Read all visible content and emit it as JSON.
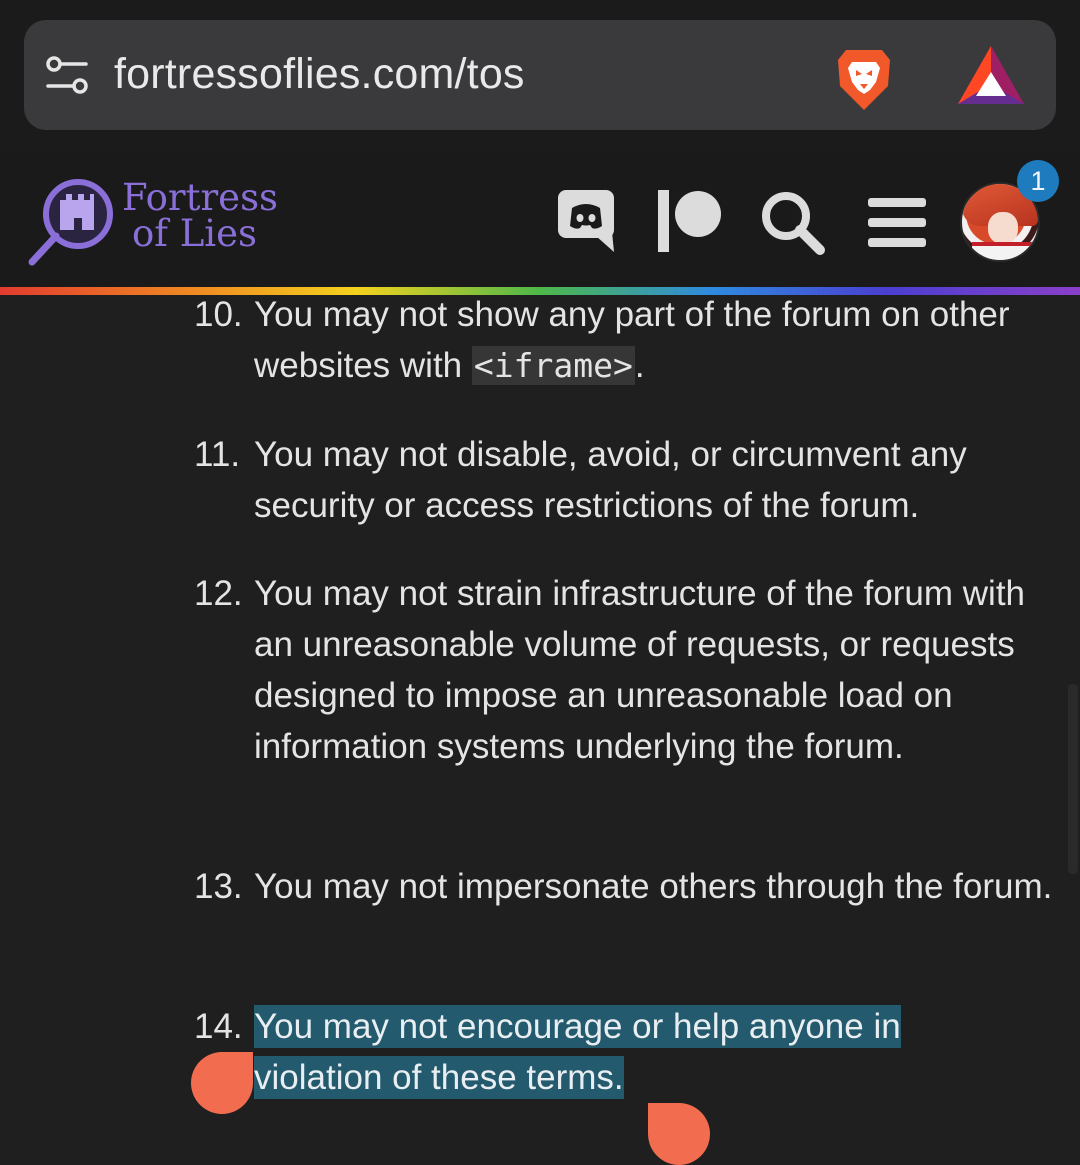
{
  "browser": {
    "url": "fortressoflies.com/tos",
    "site_settings_icon": "tune-icon",
    "shields_icon": "brave-lion-icon",
    "rewards_icon": "bat-triangle-icon"
  },
  "header": {
    "logo_line1": "Fortress",
    "logo_line2": "of Lies",
    "logo_color": "#8a6fd8",
    "icons": [
      "discord-icon",
      "patreon-icon",
      "search-icon",
      "hamburger-menu-icon"
    ],
    "notification_count": "1",
    "badge_color": "#1e7bbd"
  },
  "tos": {
    "items": [
      {
        "number": "10.",
        "text_before": "You may not show any part of the forum on other websites with ",
        "code": "<iframe>",
        "text_after": "."
      },
      {
        "number": "11.",
        "text": "You may not disable, avoid, or circumvent any security or access restrictions of the forum."
      },
      {
        "number": "12.",
        "text": "You may not strain infrastructure of the forum with an unreasonable volume of requests, or requests designed to impose an unreasonable load on information systems underlying the forum."
      },
      {
        "number": "13.",
        "text": "You may not impersonate others through the forum."
      },
      {
        "number": "14.",
        "text": "You may not encourage or help anyone in violation of these terms."
      }
    ],
    "selection_color": "#245a6e",
    "selection_handle_color": "#f26d4f"
  }
}
